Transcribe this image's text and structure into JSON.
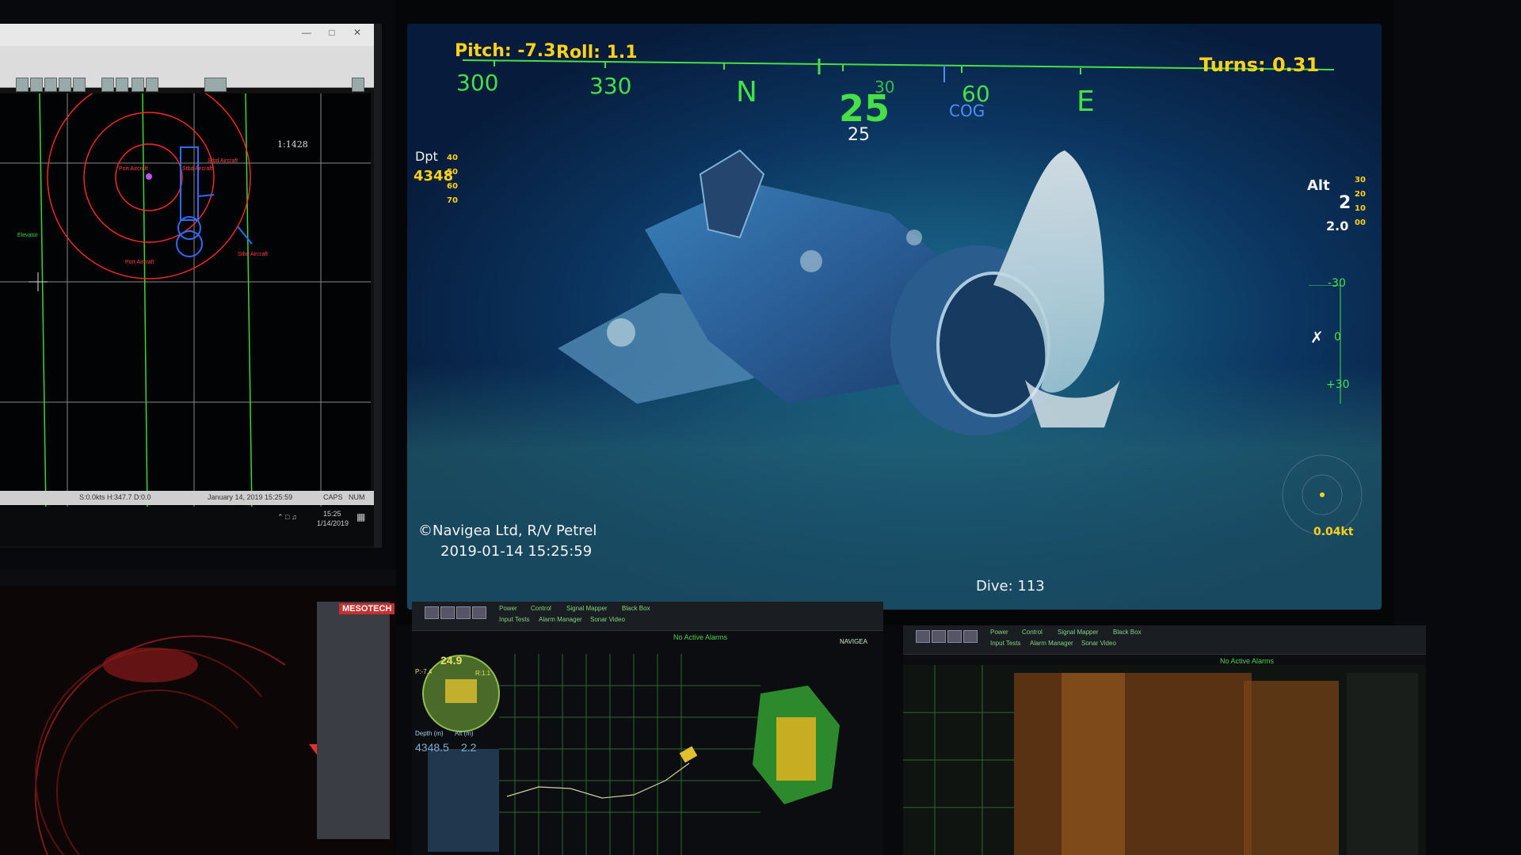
{
  "left_monitor": {
    "scale": "1:1428",
    "layer_labels": [
      "Port Aircraft",
      "Stbd Aircraft",
      "Stbd Aircraft",
      "Port Aircraft",
      "Stbd Aircraft"
    ],
    "elevator_label": "Elevator",
    "status_bar": {
      "nav": "S:0.0kts H:347.7 D:0.0",
      "datetime": "January 14, 2019 15:25:59",
      "indicators": [
        "CAPS",
        "NUM"
      ]
    },
    "taskbar": {
      "time": "15:25",
      "date": "1/14/2019"
    },
    "colors": {
      "chart_bg": "#020304",
      "grid": "#8a8a8a",
      "track_green": "#38d838",
      "range_rings": "#ff2a2a",
      "vessel": "#2f6bff"
    }
  },
  "hud": {
    "pitch": "Pitch: -7.3",
    "roll": "Roll: 1.1",
    "turns": "Turns: 0.31",
    "compass": {
      "ticks": [
        "300",
        "330",
        "N",
        "30",
        "60",
        "E"
      ],
      "heading_large": "25",
      "heading_small": "25",
      "cog_label": "COG"
    },
    "depth": {
      "label": "Dpt",
      "value": "4348",
      "scale": [
        "40",
        "50",
        "60",
        "70"
      ]
    },
    "altitude": {
      "label": "Alt",
      "value": "2",
      "sub_value": "2.0",
      "scale": [
        "30",
        "20",
        "10",
        "00"
      ]
    },
    "tilt_scale": [
      "-30",
      "0",
      "+30"
    ],
    "speed": "0.04kt",
    "copyright": "©Navigea Ltd, R/V Petrel",
    "timestamp": "2019-01-14 15:25:59",
    "dive": "Dive: 113",
    "colors": {
      "hud_yellow": "#ffd21a",
      "hud_green": "#46e046",
      "hud_blue": "#4f8cff"
    }
  },
  "sonar_monitor": {
    "brand": "MESOTECH"
  },
  "dive_monitor": {
    "heading_readout": "24.9",
    "pitch_readout": "P:-7.4",
    "roll_readout": "R:1.1",
    "depth_readout": "4348.5",
    "alt_readout": "2.2",
    "depth_label": "Depth (m)",
    "alt_label": "Alt (m)",
    "alarm": "No Active Alarms",
    "menu": [
      "Power",
      "Control",
      "Signal Mapper",
      "Black Box",
      "Input Tests",
      "Alarm Manager",
      "Sonar Video"
    ],
    "brand": "NAVIGEA"
  },
  "scan_monitor": {
    "alarm": "No Active Alarms",
    "menu": [
      "Power",
      "Control",
      "Signal Mapper",
      "Black Box",
      "Input Tests",
      "Alarm Manager",
      "Sonar Video"
    ]
  }
}
